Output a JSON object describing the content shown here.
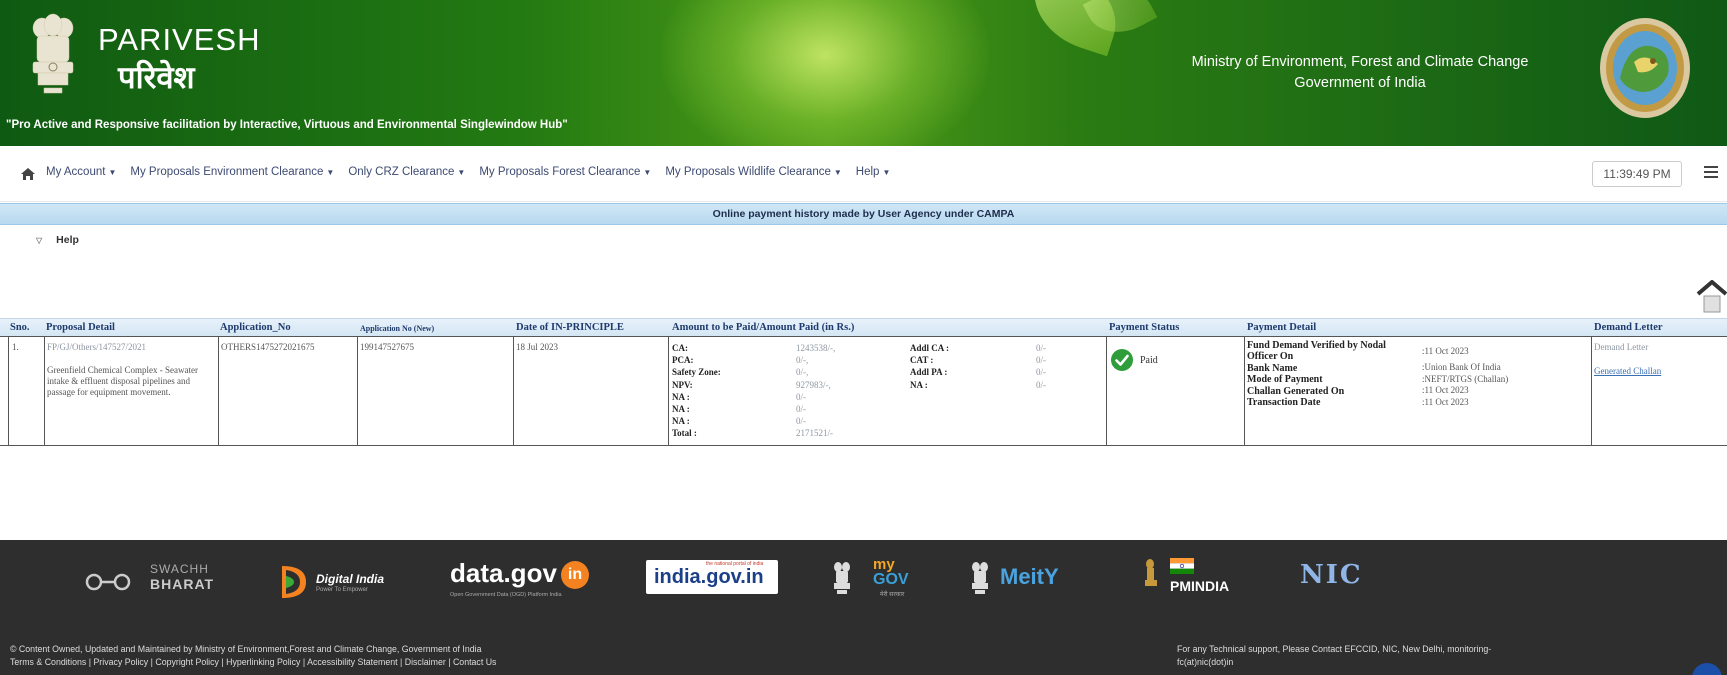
{
  "colors": {
    "header_dark": "#0f5a12",
    "header_light": "#4d9a18",
    "title_bar": "#cfe7f6",
    "table_header": "#d4e6f4",
    "link": "#3a6fb3",
    "paid_green": "#2f9d39",
    "footer": "#2e2e2e"
  },
  "header": {
    "site_name": "PARIVESH",
    "site_name_hindi": "परिवेश",
    "tagline": "\"Pro Active and Responsive facilitation by Interactive, Virtuous and Environmental Singlewindow Hub\"",
    "ministry_line1": "Ministry of Environment, Forest and Climate Change",
    "ministry_line2": "Government of India",
    "emblem_icon": "national-emblem-icon",
    "ministry_logo_icon": "ministry-seal-icon"
  },
  "nav": {
    "home_icon": "home-icon",
    "items": [
      "My Account",
      "My Proposals Environment Clearance",
      "Only CRZ Clearance",
      "My Proposals Forest Clearance",
      "My Proposals Wildlife Clearance",
      "Help"
    ],
    "clock": "11:39:49 PM",
    "menu_icon": "hamburger-menu-icon"
  },
  "title_bar": "Online payment history made by User Agency under CAMPA",
  "help_label": "Help",
  "table": {
    "headers": {
      "sno": "Sno.",
      "proposal": "Proposal Detail",
      "app_no": "Application_No",
      "app_no_new": "Application No (New)",
      "date": "Date of IN-PRINCIPLE",
      "amount": "Amount to be Paid/Amount Paid (in Rs.)",
      "status": "Payment Status",
      "detail": "Payment Detail",
      "demand": "Demand Letter"
    },
    "row": {
      "sno": "1.",
      "proposal_id": "FP/GJ/Others/147527/2021",
      "proposal_text": "Greenfield Chemical Complex - Seawater intake & effluent disposal pipelines and passage for equipment movement.",
      "app_no": "OTHERS1475272021675",
      "app_no_new": "199147527675",
      "date": "18 Jul 2023",
      "amounts_left": [
        {
          "label": "CA:",
          "value": "1243538/-,"
        },
        {
          "label": "PCA:",
          "value": "0/-,"
        },
        {
          "label": "Safety Zone:",
          "value": "0/-,"
        },
        {
          "label": "NPV:",
          "value": "927983/-,"
        },
        {
          "label": "NA :",
          "value": "0/-"
        },
        {
          "label": "NA :",
          "value": "0/-"
        },
        {
          "label": "NA :",
          "value": "0/-"
        },
        {
          "label": "Total :",
          "value": "2171521/-"
        }
      ],
      "amounts_right": [
        {
          "label": "Addl CA :",
          "value": "0/-"
        },
        {
          "label": "CAT :",
          "value": "0/-"
        },
        {
          "label": "Addl PA :",
          "value": "0/-"
        },
        {
          "label": "NA :",
          "value": "0/-"
        }
      ],
      "status_label": "Paid",
      "status_icon": "check-circle-icon",
      "details": [
        {
          "label": "Fund Demand Verified by Nodal Officer On",
          "value": ":11 Oct 2023"
        },
        {
          "label": "Bank Name",
          "value": ":Union Bank Of India"
        },
        {
          "label": "Mode of Payment",
          "value": ":NEFT/RTGS (Challan)"
        },
        {
          "label": "Challan Generated On",
          "value": ":11 Oct 2023"
        },
        {
          "label": "Transaction Date",
          "value": ":11 Oct 2023"
        }
      ],
      "demand_letter": "Demand Letter",
      "generated_challan": "Generated Challan"
    }
  },
  "footer": {
    "logos": {
      "swachh_1": "SWACHH",
      "swachh_2": "BHARAT",
      "digital_india": "Digital India",
      "digital_india_sub": "Power To Empower",
      "datagov": "data.gov",
      "datagov_in": "in",
      "datagov_sub": "Open Government Data (OGD) Platform India",
      "indiagov": "india.gov.in",
      "indiagov_sub": "the national portal of india",
      "mygov_my": "my",
      "mygov_gov": "GOV",
      "mygov_sub": "मेरी सरकार",
      "meity": "MeitY",
      "pmindia": "PMINDIA",
      "nic": "NIC"
    },
    "left_line1": "© Content Owned, Updated and Maintained by Ministry of Environment,Forest and Climate Change, Government of India",
    "left_line2": "Terms & Conditions | Privacy Policy | Copyright Policy | Hyperlinking Policy | Accessibility Statement | Disclaimer | Contact Us",
    "right_line1": "For any Technical support, Please Contact EFCCID, NIC, New Delhi, monitoring-",
    "right_line2": "fc(at)nic(dot)in",
    "chat_icon": "chat-help-icon"
  }
}
